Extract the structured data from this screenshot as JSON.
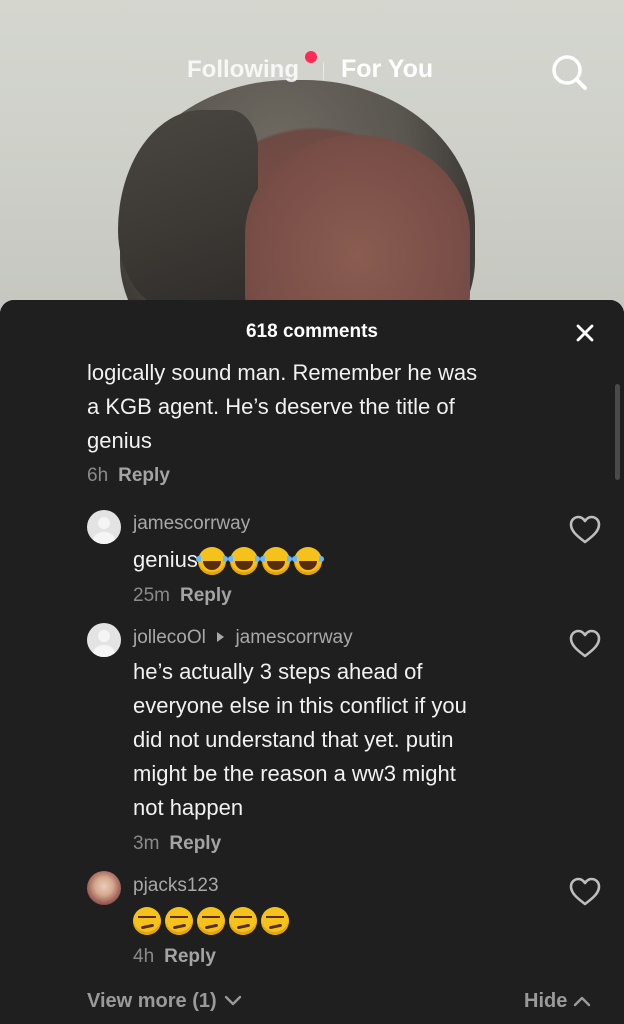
{
  "nav": {
    "following_label": "Following",
    "foryou_label": "For You",
    "search_icon": "search-icon"
  },
  "sheet": {
    "title": "618 comments",
    "close_icon": "close-icon"
  },
  "comments": [
    {
      "text_lines": [
        "logically sound man. Remember he was",
        "a KGB agent. He’s deserve the title of",
        "genius"
      ],
      "time": "6h",
      "reply_label": "Reply"
    },
    {
      "username": "jamescorrway",
      "text": "genius",
      "emoji": "laughing-crying",
      "emoji_count": 4,
      "time": "25m",
      "reply_label": "Reply"
    },
    {
      "username": "jollecoOl",
      "reply_to": "jamescorrway",
      "text_lines": [
        "he’s actually 3 steps ahead of",
        "everyone else in this conflict if you",
        "did not understand that yet. putin",
        "might be the reason a ww3 might",
        "not happen"
      ],
      "time": "3m",
      "reply_label": "Reply"
    },
    {
      "username": "pjacks123",
      "emoji": "smirking-face",
      "emoji_count": 5,
      "time": "4h",
      "reply_label": "Reply"
    }
  ],
  "footer": {
    "view_more": "View more (1)",
    "hide": "Hide"
  },
  "colors": {
    "accent_dot": "#fe2c55",
    "sheet_bg": "#1f1f1f"
  }
}
